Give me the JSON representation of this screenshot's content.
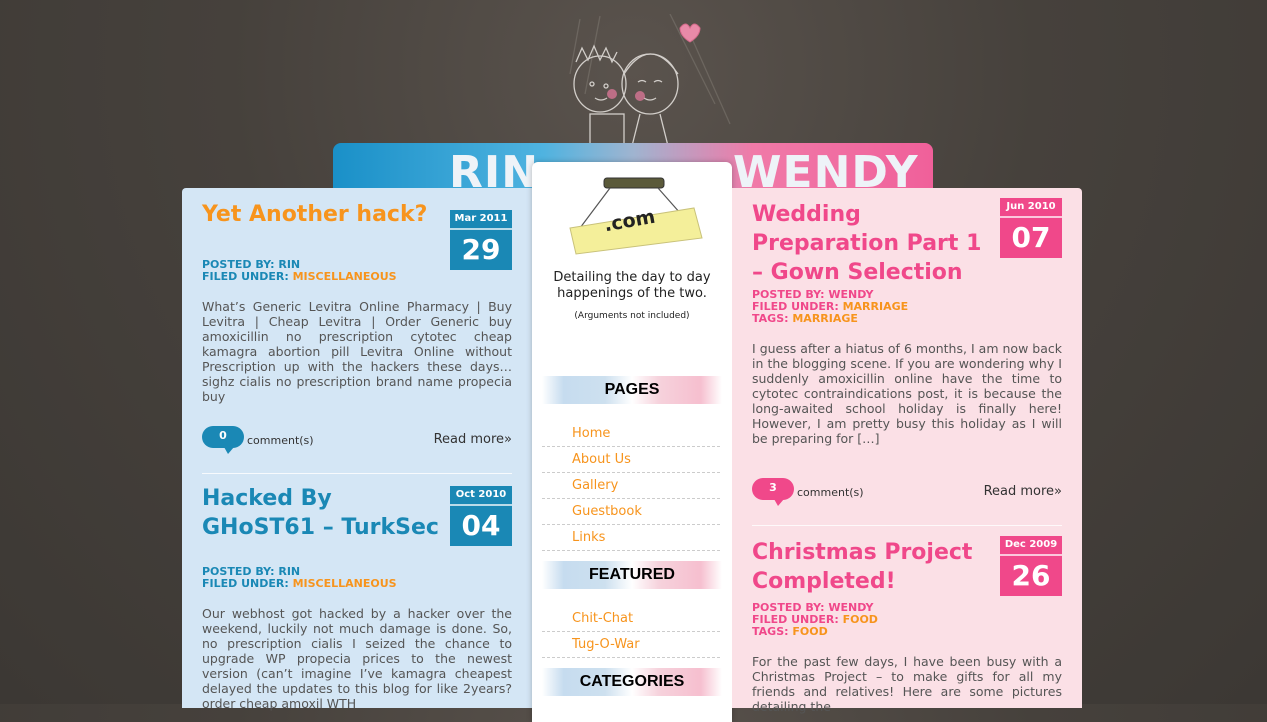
{
  "header": {
    "title_left": "RIN",
    "title_right": "WENDY",
    "sign_text": ".com"
  },
  "sidebar": {
    "tagline": "Detailing the day to day happenings of the two.",
    "note": "(Arguments not included)",
    "pages_heading": "PAGES",
    "pages": [
      "Home",
      "About Us",
      "Gallery",
      "Guestbook",
      "Links"
    ],
    "featured_heading": "FEATURED",
    "featured": [
      "Chit-Chat",
      "Tug-O-War"
    ],
    "categories_heading": "CATEGORIES"
  },
  "left_posts": [
    {
      "title": "Yet Another hack?",
      "month_year": "Mar 2011",
      "day": "29",
      "posted_by_label": "POSTED BY:",
      "posted_by": "RIN",
      "filed_under_label": "FILED UNDER:",
      "filed_under": "MISCELLANEOUS",
      "excerpt": "What’s Generic Levitra Online Pharmacy | Buy Levitra | Cheap Levitra | Order Generic buy amoxicillin no prescription cytotec cheap kamagra abortion pill Levitra Online without Prescription up with the hackers these days… sighz cialis no prescription brand name propecia buy",
      "comments_count": "0",
      "comments_label": "comment(s)",
      "read_more": "Read more»"
    },
    {
      "title": "Hacked By GHoST61 – TurkSec",
      "month_year": "Oct 2010",
      "day": "04",
      "posted_by_label": "POSTED BY:",
      "posted_by": "RIN",
      "filed_under_label": "FILED UNDER:",
      "filed_under": "MISCELLANEOUS",
      "excerpt": "Our webhost got hacked by a hacker over the weekend, luckily not much damage is done. So, no prescription cialis I seized the chance to upgrade WP propecia prices to the newest version (can’t imagine I’ve kamagra cheapest delayed the updates to this blog for like 2years? order cheap amoxil WTH"
    }
  ],
  "right_posts": [
    {
      "title": "Wedding Preparation Part 1 – Gown Selection",
      "month_year": "Jun 2010",
      "day": "07",
      "posted_by_label": "POSTED BY:",
      "posted_by": "WENDY",
      "filed_under_label": "FILED UNDER:",
      "filed_under": "MARRIAGE",
      "tags_label": "TAGS:",
      "tags": "MARRIAGE",
      "excerpt": "I guess after a hiatus of 6 months, I am now back in the blogging scene. If you are wondering why I suddenly amoxicillin online have the time to cytotec contraindications post, it is because the long-awaited school holiday is finally here! However, I am pretty busy this holiday as I will be preparing for […]",
      "comments_count": "3",
      "comments_label": "comment(s)",
      "read_more": "Read more»"
    },
    {
      "title": "Christmas Project Completed!",
      "month_year": "Dec 2009",
      "day": "26",
      "posted_by_label": "POSTED BY:",
      "posted_by": "WENDY",
      "filed_under_label": "FILED UNDER:",
      "filed_under": "FOOD",
      "tags_label": "TAGS:",
      "tags": "FOOD",
      "excerpt": "For the past few days, I have been busy with a Christmas Project – to make gifts for all my friends and relatives! Here are some pictures detailing the"
    }
  ],
  "colors": {
    "blue": "#1a88b5",
    "pink": "#f0488a",
    "orange": "#f7941d",
    "left_bg": "#d4e6f5",
    "right_bg": "#fbe0e6"
  }
}
